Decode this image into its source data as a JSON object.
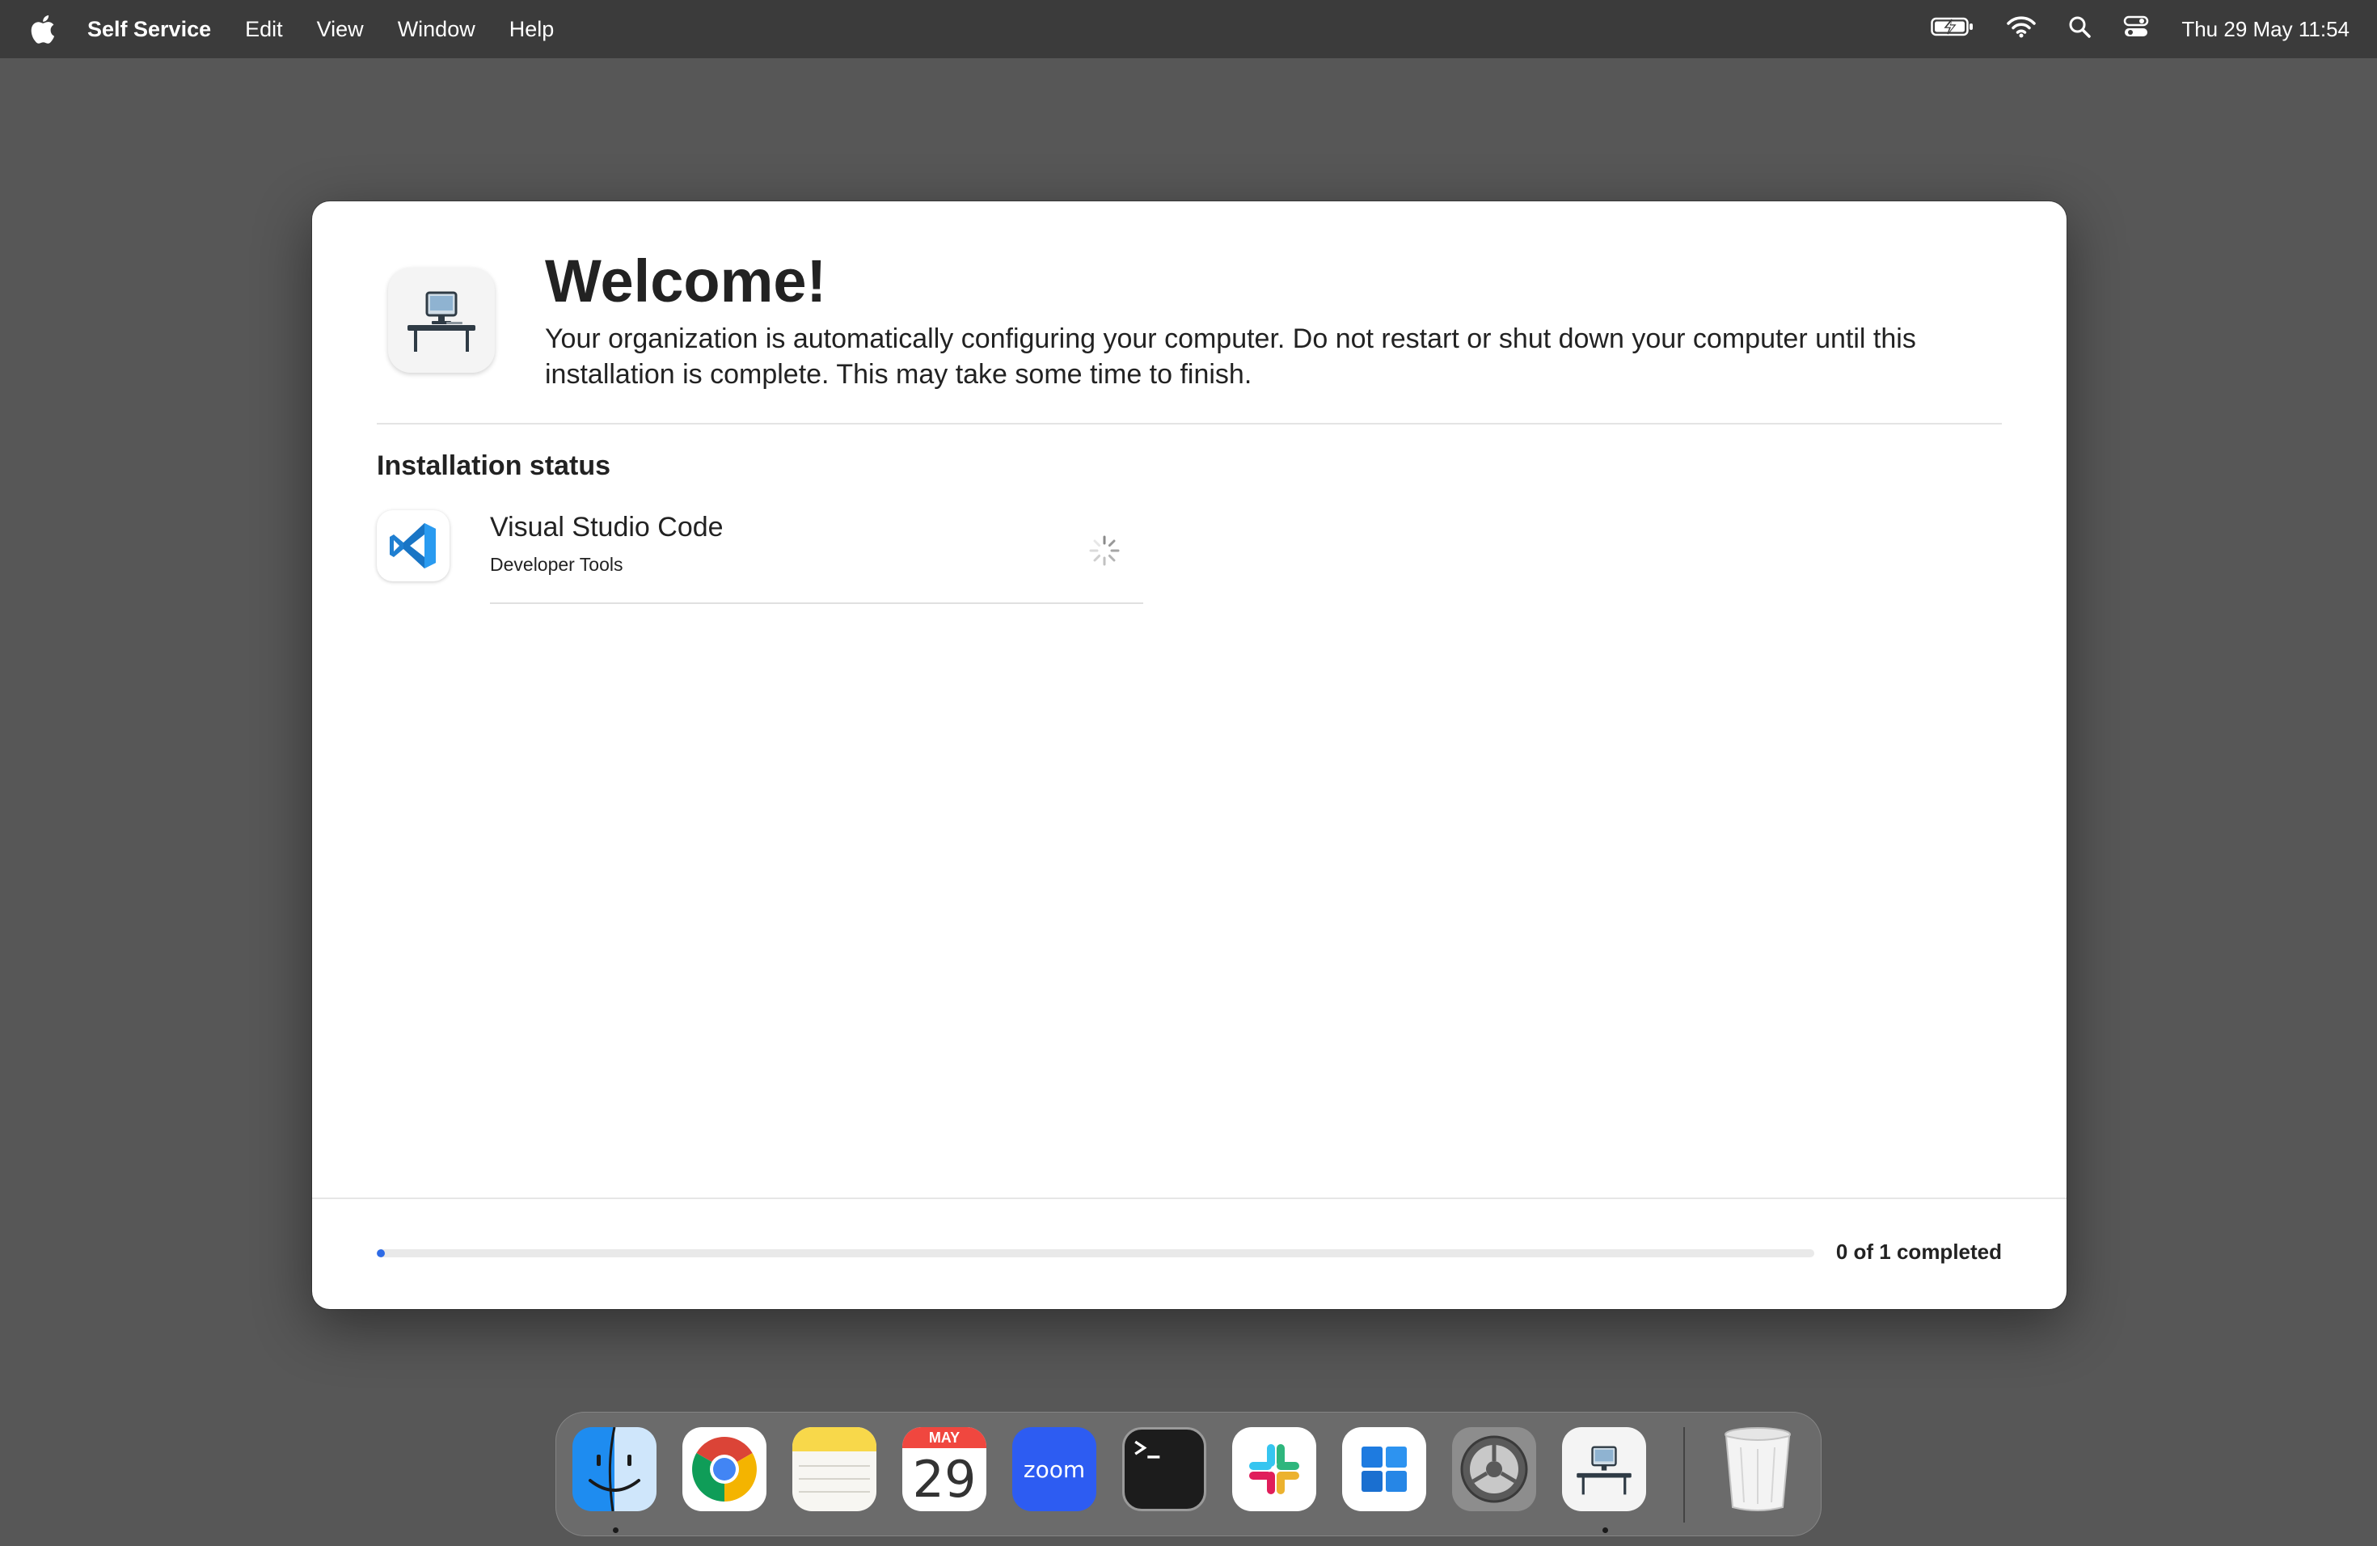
{
  "menubar": {
    "app_name": "Self Service",
    "items": [
      "Edit",
      "View",
      "Window",
      "Help"
    ],
    "clock": "Thu 29 May  11:54",
    "icons": [
      "battery-charging-icon",
      "wifi-icon",
      "spotlight-search-icon",
      "control-center-icon"
    ]
  },
  "window": {
    "title": "Welcome!",
    "subtitle": "Your organization is automatically configuring your computer. Do not restart or shut down your computer until this installation is complete. This may take some time to finish.",
    "section_title": "Installation status",
    "apps": [
      {
        "name": "Visual Studio Code",
        "category": "Developer Tools",
        "status": "installing"
      }
    ],
    "progress": {
      "completed": 0,
      "total": 1,
      "label": "0 of 1 completed",
      "accent": "#2e6be6"
    }
  },
  "dock": {
    "items": [
      "finder",
      "chrome",
      "notes",
      "calendar",
      "zoom",
      "terminal",
      "slack",
      "windows-app",
      "system-settings",
      "self-service",
      "trash"
    ],
    "calendar": {
      "month": "MAY",
      "day": "29"
    },
    "zoom_label": "zoom"
  }
}
